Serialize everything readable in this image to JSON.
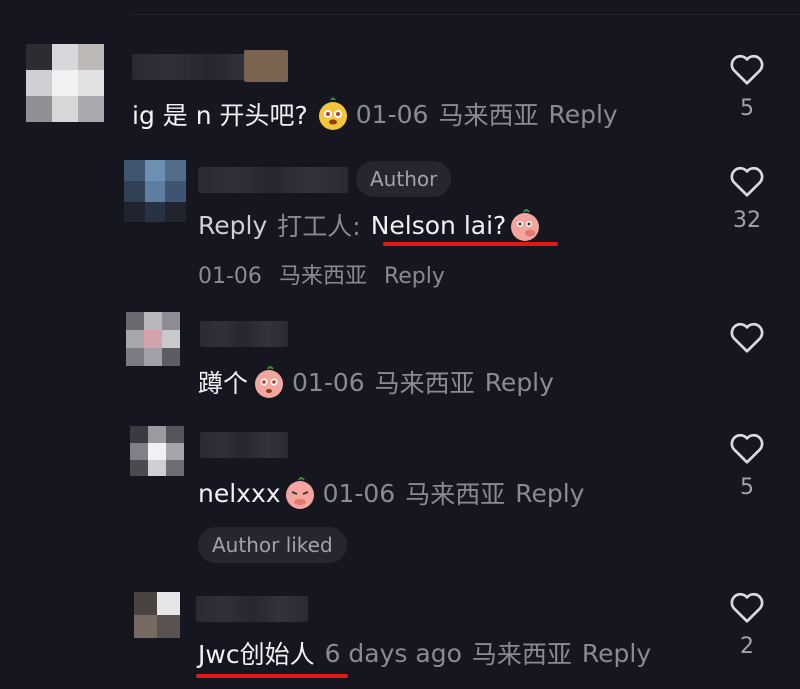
{
  "comments": [
    {
      "text": "ig 是 n 开头吧?",
      "date": "01-06",
      "region": "马来西亚",
      "reply": "Reply",
      "likes": "5",
      "sticker": "yellow-bear-sticker"
    },
    {
      "badge": "Author",
      "prefix": "Reply",
      "to": "打工人:",
      "text": "Nelson lai?",
      "date": "01-06",
      "region": "马来西亚",
      "reply": "Reply",
      "likes": "32",
      "sticker": "peach-whisper-sticker"
    },
    {
      "text": "蹲个",
      "date": "01-06",
      "region": "马来西亚",
      "reply": "Reply",
      "sticker": "peach-nervous-sticker"
    },
    {
      "text": "nelxxx",
      "date": "01-06",
      "region": "马来西亚",
      "reply": "Reply",
      "likes": "5",
      "badge": "Author liked",
      "sticker": "peach-shy-sticker"
    },
    {
      "text": "Jwc创始人",
      "date": "6 days ago",
      "region": "马来西亚",
      "reply": "Reply",
      "likes": "2"
    }
  ],
  "colors": {
    "background": "#161620",
    "underline": "#e01818",
    "muted": "#8a8a95"
  }
}
